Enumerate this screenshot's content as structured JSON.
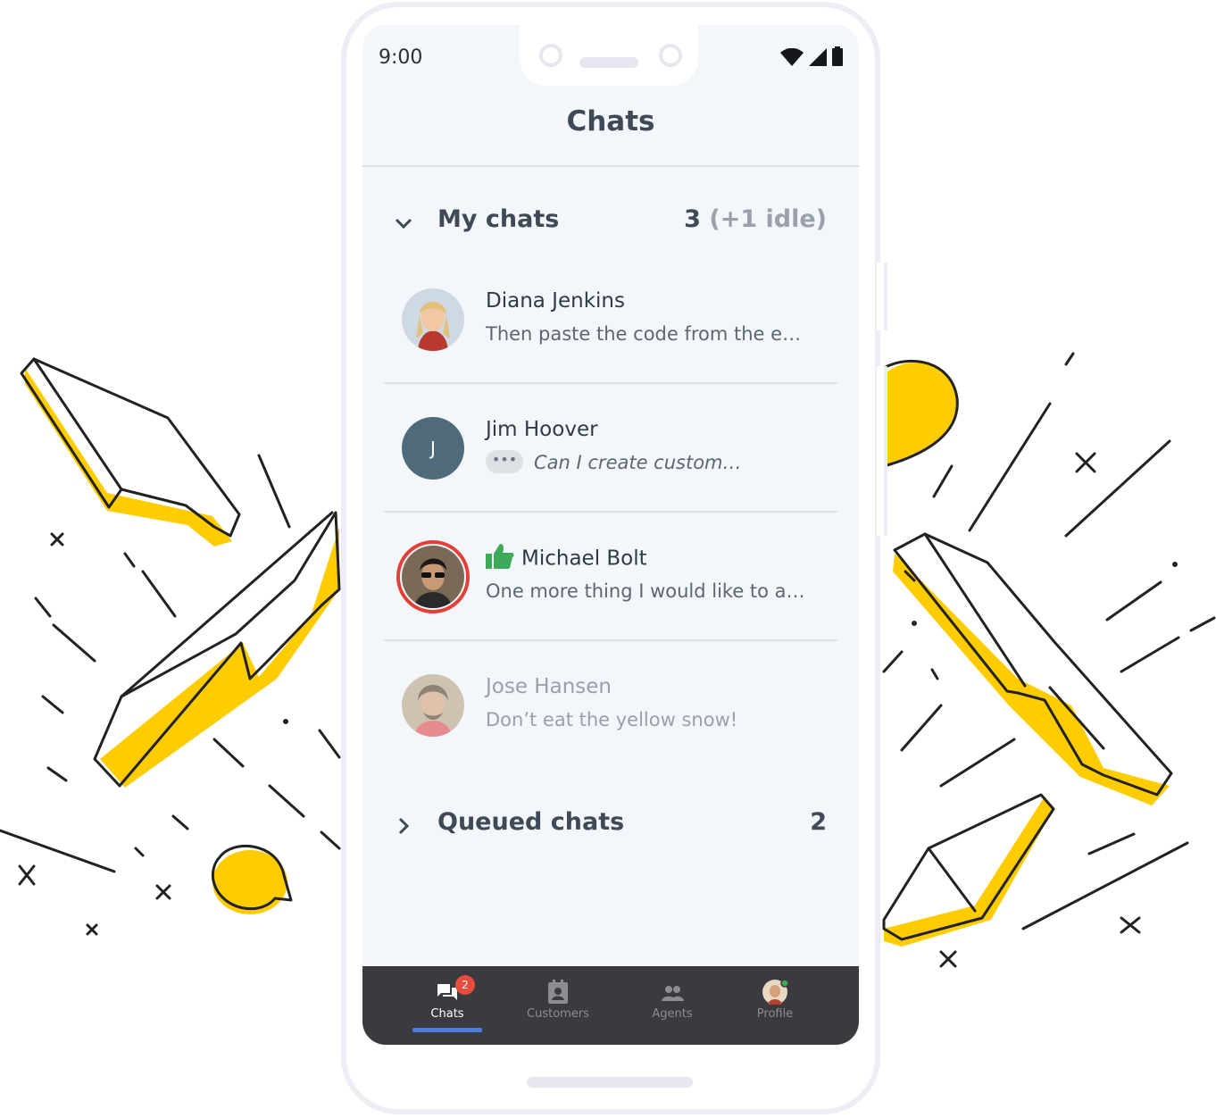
{
  "status_bar": {
    "time": "9:00"
  },
  "header": {
    "title": "Chats"
  },
  "my_chats": {
    "label": "My chats",
    "count": "3",
    "idle": "(+1 idle)",
    "items": [
      {
        "name": "Diana Jenkins",
        "preview": "Then paste the code from the e…",
        "avatar": "photo"
      },
      {
        "name": "Jim Hoover",
        "preview": "Can I create custom…",
        "avatar_letter": "J",
        "typing": "•••"
      },
      {
        "name": "Michael Bolt",
        "preview": "One more thing I would like to a…",
        "avatar": "photo",
        "rating_icon": "thumbs-up-icon"
      },
      {
        "name": "Jose Hansen",
        "preview": "Don’t eat the yellow snow!",
        "avatar": "photo",
        "idle": true
      }
    ]
  },
  "queued_chats": {
    "label": "Queued chats",
    "count": "2"
  },
  "bottom_nav": {
    "items": [
      {
        "label": "Chats",
        "icon": "chat-bubbles-icon",
        "badge": "2",
        "active": true
      },
      {
        "label": "Customers",
        "icon": "contacts-icon"
      },
      {
        "label": "Agents",
        "icon": "people-icon"
      },
      {
        "label": "Profile",
        "icon": "avatar-icon",
        "status": "online"
      }
    ]
  },
  "colors": {
    "accent_underline": "#4a7ee3",
    "badge": "#e74c3c",
    "nav_background": "#3b3a3f",
    "screen_background": "#f3f6fa",
    "decoration_yellow": "#ffcc00",
    "thumbs_up": "#3daa5a",
    "ring": "#e23f36"
  }
}
